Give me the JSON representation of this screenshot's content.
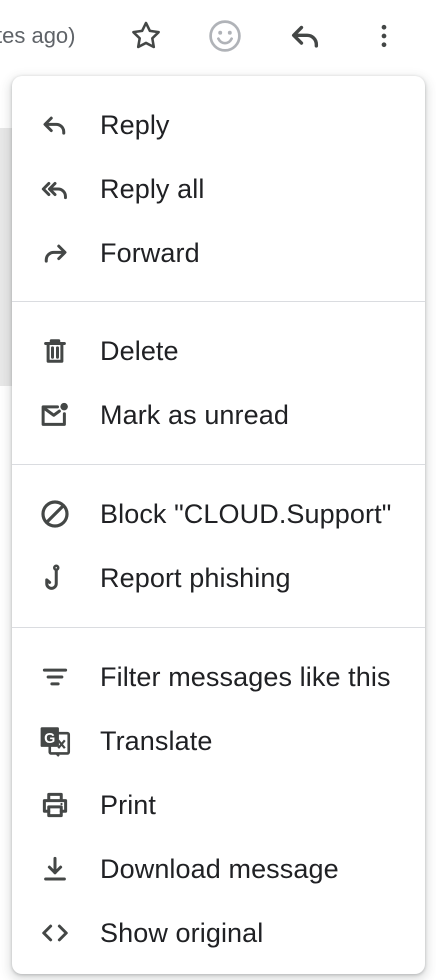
{
  "topbar": {
    "time_text": "tes ago)",
    "star_icon": "star-icon",
    "emoji_icon": "emoji-reaction-icon",
    "reply_icon": "reply-icon",
    "more_icon": "more-vert-icon"
  },
  "menu": {
    "groups": [
      {
        "items": [
          {
            "label": "Reply",
            "icon": "reply-icon"
          },
          {
            "label": "Reply all",
            "icon": "reply-all-icon"
          },
          {
            "label": "Forward",
            "icon": "forward-icon"
          }
        ]
      },
      {
        "items": [
          {
            "label": "Delete",
            "icon": "trash-icon"
          },
          {
            "label": "Mark as unread",
            "icon": "mark-unread-icon"
          }
        ]
      },
      {
        "items": [
          {
            "label": "Block \"CLOUD.Support\"",
            "icon": "block-icon"
          },
          {
            "label": "Report phishing",
            "icon": "phishing-hook-icon"
          }
        ]
      },
      {
        "items": [
          {
            "label": "Filter messages like this",
            "icon": "filter-icon"
          },
          {
            "label": "Translate",
            "icon": "translate-icon"
          },
          {
            "label": "Print",
            "icon": "print-icon"
          },
          {
            "label": "Download message",
            "icon": "download-icon"
          },
          {
            "label": "Show original",
            "icon": "code-icon"
          }
        ]
      }
    ]
  },
  "colors": {
    "text": "#202124",
    "icon": "#444746",
    "muted": "#5f6368",
    "divider": "#dadce0",
    "emoji": "#b0b3b8"
  }
}
